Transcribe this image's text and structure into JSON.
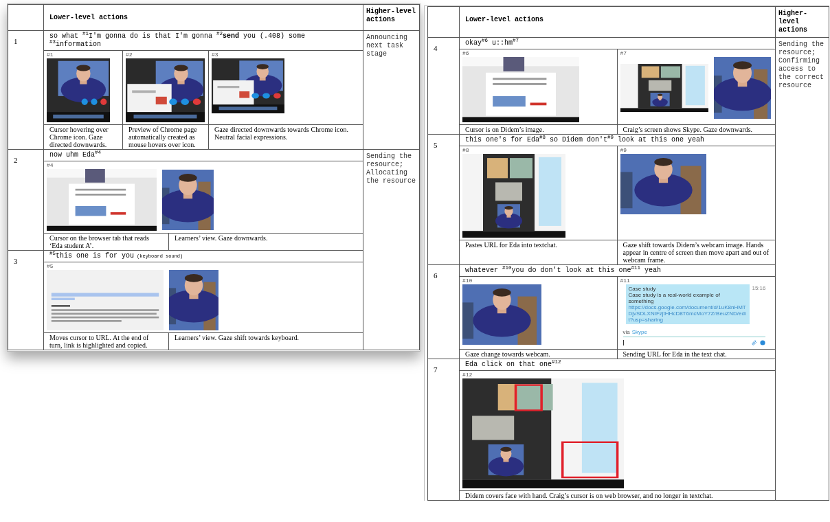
{
  "pages": [
    {
      "header": {
        "lower": "Lower-level actions",
        "higher": "Higher-level actions"
      },
      "groups": [
        {
          "higher": "Announcing next task stage",
          "rows": [
            {
              "number": "1",
              "utterance": "so what $^{#1}$I'm gonna do is that I'm gonna $^{#2}$**send** you (.408) some $^{#3}$information",
              "panels": [
                {
                  "label": "#1"
                },
                {
                  "label": "#2"
                },
                {
                  "label": "#3"
                }
              ],
              "captions": [
                "Cursor hovering over Chrome icon. Gaze directed downwards.",
                "Preview of Chrome page automatically created as mouse hovers over icon.",
                "Gaze directed downwards towards Chrome icon. Neutral facial expressions."
              ]
            }
          ]
        },
        {
          "higher": "Sending the resource; Allocating the resource",
          "rows": [
            {
              "number": "2",
              "utterance": "now uhm Eda$^{#4}$",
              "panels": [
                {
                  "label": "#4"
                }
              ],
              "captions": [
                "Cursor on the browser tab that reads ‘Eda student A’.",
                "Learners’ view. Gaze downwards."
              ]
            },
            {
              "number": "3",
              "utterance": "$^{#5}$this one is for you",
              "note": "(keyboard sound)",
              "panels": [
                {
                  "label": "#5"
                }
              ],
              "captions": [
                "Moves cursor to URL. At the end of turn, link is highlighted and copied.",
                "Learners’ view. Gaze shift towards keyboard."
              ]
            }
          ]
        }
      ]
    },
    {
      "header": {
        "lower": "Lower-level actions",
        "higher": "Higher-level actions"
      },
      "groups": [
        {
          "higher": "Sending the resource; Confirming access to the correct resource",
          "rows": [
            {
              "number": "4",
              "utterance": "okay$^{#6}$ u::hm$^{#7}$",
              "panels": [
                {
                  "label": "#6"
                },
                {
                  "label": "#7"
                }
              ],
              "captions": [
                "Cursor is on Didem’s image.",
                "Craig’s screen shows Skype. Gaze downwards."
              ]
            },
            {
              "number": "5",
              "utterance": "this one's for Eda$^{#8}$ so Didem don't$^{#9}$ look at this one yeah",
              "panels": [
                {
                  "label": "#8"
                },
                {
                  "label": "#9"
                }
              ],
              "captions": [
                "Pastes URL for Eda into textchat.",
                "Gaze shift towards Didem’s webcam image. Hands appear in centre of screen then move apart and out of webcam frame."
              ]
            },
            {
              "number": "6",
              "utterance": "whatever $^{#10}$you do don't look at this one$^{#11}$ yeah",
              "panels": [
                {
                  "label": "#10"
                },
                {
                  "label": "#11",
                  "pictures": [
                    {
                      "kind": "chat",
                      "title": "Case study",
                      "time": "15:16",
                      "message": "Case study is a real-world example of something",
                      "link": "https://docs.google.com/document/d/1uK8nHMTDjvSDLXNIFzjtHHcD8T6mcMoY7ZrBeuZND/edit?usp=sharing",
                      "via": "via",
                      "service": "Skype"
                    }
                  ]
                }
              ],
              "captions": [
                "Gaze change towards webcam.",
                "Sending URL for Eda in the text chat."
              ]
            },
            {
              "number": "7",
              "utterance": "Eda click on that one$^{#12}$",
              "panels": [
                {
                  "label": "#12"
                }
              ],
              "captions": [
                "Didem covers face with hand. Craig’s cursor is on web browser, and no longer in textchat."
              ]
            }
          ]
        }
      ]
    }
  ]
}
